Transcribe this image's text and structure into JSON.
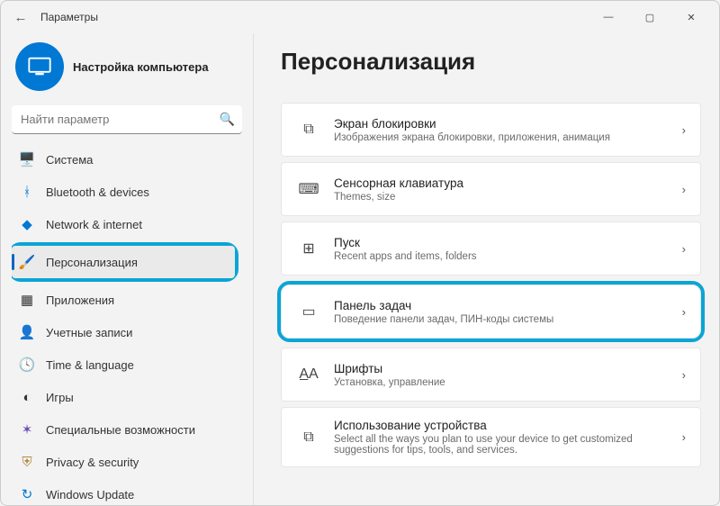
{
  "window": {
    "title": "Параметры"
  },
  "profile": {
    "name": "Настройка компьютера"
  },
  "search": {
    "placeholder": "Найти параметр"
  },
  "sidebar": {
    "items": [
      {
        "label": "Система",
        "icon": "display-icon",
        "glyph": "🖥️",
        "color": "c-blue"
      },
      {
        "label": "Bluetooth & devices",
        "icon": "bluetooth-icon",
        "glyph": "ᚼ",
        "color": "c-blue"
      },
      {
        "label": "Network & internet",
        "icon": "wifi-icon",
        "glyph": "◆",
        "color": "c-blue"
      },
      {
        "label": "Персонализация",
        "icon": "brush-icon",
        "glyph": "🖌️",
        "color": "c-orange",
        "selected": true,
        "highlighted": true
      },
      {
        "label": "Приложения",
        "icon": "apps-icon",
        "glyph": "▦",
        "color": ""
      },
      {
        "label": "Учетные записи",
        "icon": "account-icon",
        "glyph": "👤",
        "color": "c-teal"
      },
      {
        "label": "Time & language",
        "icon": "clock-icon",
        "glyph": "🕓",
        "color": ""
      },
      {
        "label": "Игры",
        "icon": "gaming-icon",
        "glyph": "◐",
        "color": ""
      },
      {
        "label": "Специальные возможности",
        "icon": "accessibility-icon",
        "glyph": "✶",
        "color": "c-purple"
      },
      {
        "label": "Privacy & security",
        "icon": "shield-icon",
        "glyph": "⛨",
        "color": "c-gold"
      },
      {
        "label": "Windows Update",
        "icon": "update-icon",
        "glyph": "↻",
        "color": "c-blue"
      }
    ]
  },
  "page": {
    "title": "Персонализация"
  },
  "cards": [
    {
      "title": "Экран блокировки",
      "desc": "Изображения экрана блокировки, приложения, анимация",
      "icon": "lock-screen-icon",
      "glyph": "⧉"
    },
    {
      "title": "Сенсорная клавиатура",
      "desc": "Themes, size",
      "icon": "keyboard-icon",
      "glyph": "⌨"
    },
    {
      "title": "Пуск",
      "desc": "Recent apps and items, folders",
      "icon": "start-icon",
      "glyph": "⊞"
    },
    {
      "title": "Панель задач",
      "desc": "Поведение панели задач, ПИН-коды системы",
      "icon": "taskbar-icon",
      "glyph": "▭",
      "highlighted": true
    },
    {
      "title": "Шрифты",
      "desc": "Установка, управление",
      "icon": "fonts-icon",
      "glyph": "A̲A"
    },
    {
      "title": "Использование устройства",
      "desc": "Select all the ways you plan to use your device to get customized suggestions for tips, tools, and services.",
      "icon": "device-usage-icon",
      "glyph": "⧉"
    }
  ]
}
